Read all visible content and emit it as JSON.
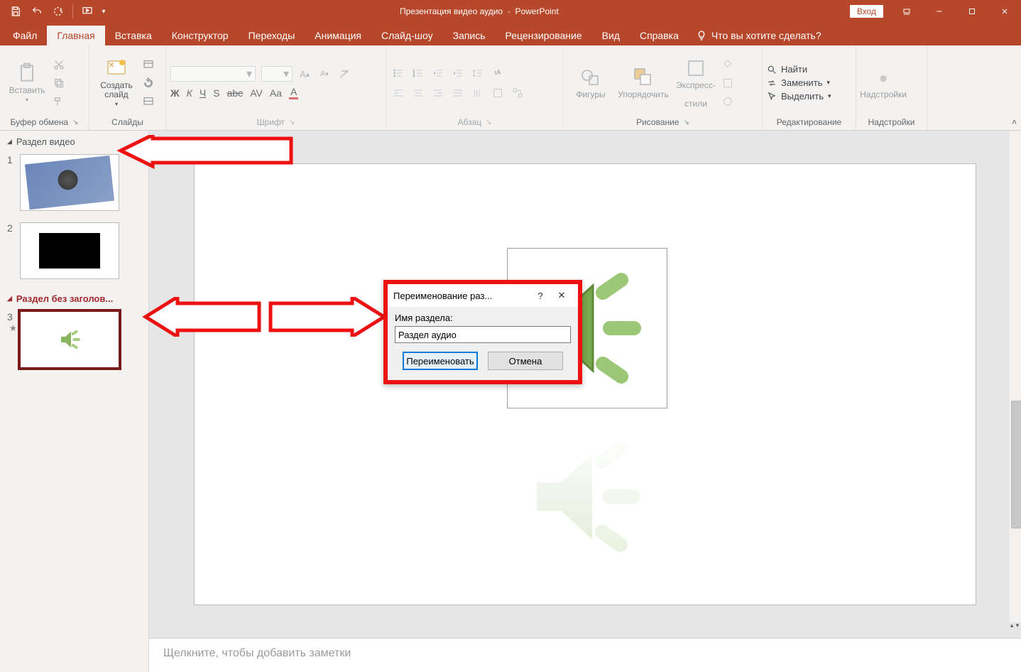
{
  "title": {
    "doc": "Презентация видео аудио",
    "sep": "-",
    "app": "PowerPoint"
  },
  "login_button": "Вход",
  "tabs": {
    "file": "Файл",
    "home": "Главная",
    "insert": "Вставка",
    "design": "Конструктор",
    "transitions": "Переходы",
    "animations": "Анимация",
    "slideshow": "Слайд-шоу",
    "record": "Запись",
    "review": "Рецензирование",
    "view": "Вид",
    "help": "Справка",
    "tell_me": "Что вы хотите сделать?"
  },
  "ribbon": {
    "clipboard": {
      "paste": "Вставить",
      "group": "Буфер обмена"
    },
    "slides": {
      "new_slide": "Создать слайд",
      "group": "Слайды"
    },
    "font": {
      "group": "Шрифт",
      "bold": "Ж",
      "italic": "К",
      "underline": "Ч",
      "shadow": "S",
      "strike": "abc",
      "spacing": "AV",
      "case": "Aa",
      "color": "A"
    },
    "paragraph": {
      "group": "Абзац"
    },
    "drawing": {
      "shapes": "Фигуры",
      "arrange": "Упорядочить",
      "styles_l1": "Экспресс-",
      "styles_l2": "стили",
      "group": "Рисование"
    },
    "editing": {
      "find": "Найти",
      "replace": "Заменить",
      "select": "Выделить",
      "group": "Редактирование"
    },
    "addins": {
      "label": "Надстройки",
      "group": "Надстройки"
    }
  },
  "sections": {
    "video": "Раздел видео",
    "untitled": "Раздел без заголов..."
  },
  "slides": {
    "n1": "1",
    "n2": "2",
    "n3": "3"
  },
  "dialog": {
    "title": "Переименование раз...",
    "label": "Имя раздела:",
    "value": "Раздел аудио",
    "rename": "Переименовать",
    "cancel": "Отмена"
  },
  "notes_placeholder": "Щелкните, чтобы добавить заметки"
}
